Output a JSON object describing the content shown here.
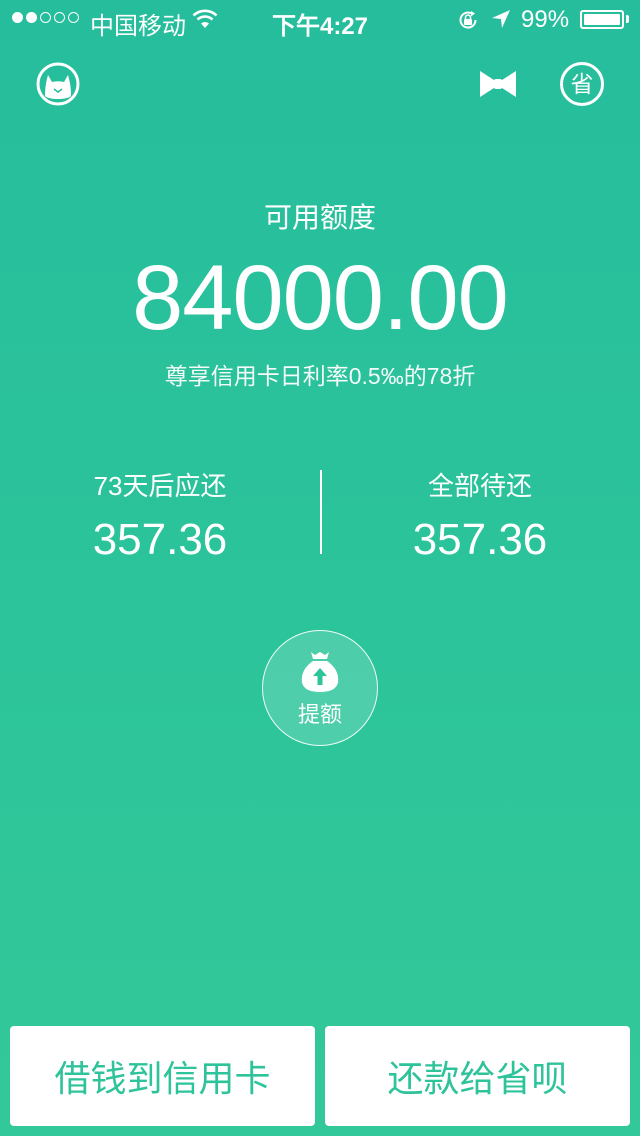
{
  "status_bar": {
    "carrier": "中国移动",
    "time": "下午4:27",
    "battery": "99%",
    "signal_filled": 2,
    "signal_total": 5
  },
  "nav": {
    "left_icon": "cat-icon",
    "right_icons": [
      "bowtie-icon",
      "sheng-icon"
    ],
    "sheng_char": "省"
  },
  "credit": {
    "label": "可用额度",
    "amount": "84000.00",
    "note": "尊享信用卡日利率0.5‰的78折"
  },
  "repayment": {
    "due_label": "73天后应还",
    "due_amount": "357.36",
    "total_label": "全部待还",
    "total_amount": "357.36"
  },
  "raise_button": {
    "label": "提额",
    "icon": "money-bag-up-icon"
  },
  "actions": {
    "borrow_label": "借钱到信用卡",
    "repay_label": "还款给省呗"
  },
  "colors": {
    "background_top": "#26bd9d",
    "background_bottom": "#33c899",
    "accent": "#2ec39a"
  }
}
